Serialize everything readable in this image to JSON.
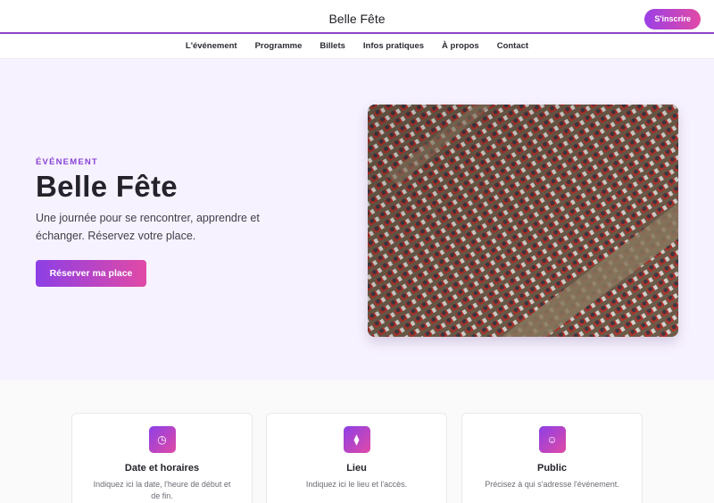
{
  "header": {
    "brand": "Belle Fête",
    "signup_label": "S'inscrire"
  },
  "nav": {
    "items": [
      "L'événement",
      "Programme",
      "Billets",
      "Infos pratiques",
      "À propos",
      "Contact"
    ]
  },
  "hero": {
    "eyebrow": "ÉVÉNEMENT",
    "title": "Belle Fête",
    "subtitle": "Une journée pour se rencontrer, apprendre et échanger. Réservez votre place.",
    "cta_label": "Réserver ma place",
    "image_name": "auditorium-photo"
  },
  "features": [
    {
      "icon": "clock-icon",
      "glyph": "◷",
      "title": "Date et horaires",
      "text": "Indiquez ici la date, l'heure de début et de fin."
    },
    {
      "icon": "location-pin-icon",
      "glyph": "⧫",
      "title": "Lieu",
      "text": "Indiquez ici le lieu et l'accès."
    },
    {
      "icon": "people-icon",
      "glyph": "☺",
      "title": "Public",
      "text": "Précisez à qui s'adresse l'événement."
    }
  ],
  "colors": {
    "accent_start": "#8d3fe6",
    "accent_end": "#e14aa6",
    "hero_bg": "#f7f2ff"
  }
}
